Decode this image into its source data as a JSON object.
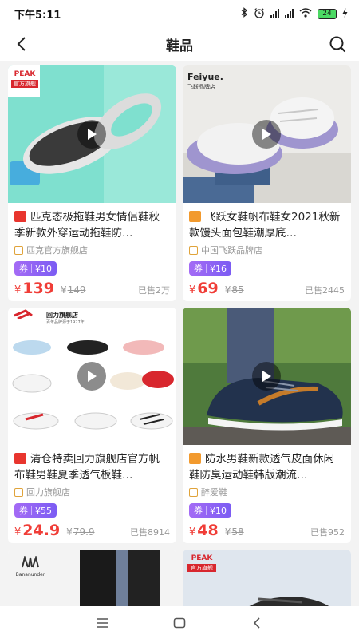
{
  "status": {
    "time": "下午5:11",
    "battery": "24"
  },
  "header": {
    "title": "鞋品"
  },
  "products": [
    {
      "name": "匹克态极拖鞋男女情侣鞋秋季新款外穿运动拖鞋防…",
      "shop": "匹克官方旗舰店",
      "coupon_label": "券",
      "coupon_value": "¥10",
      "price_symbol": "¥",
      "price": "139",
      "orig_symbol": "¥",
      "orig_price": "149",
      "sold": "已售2万",
      "brand_text": "PEAK",
      "brand_sub": "官方旗舰",
      "mall_color": "#e8352e"
    },
    {
      "name": "飞跃女鞋帆布鞋女2021秋新款馒头面包鞋潮厚底…",
      "shop": "中国飞跃品牌店",
      "coupon_label": "券",
      "coupon_value": "¥16",
      "price_symbol": "¥",
      "price": "69",
      "orig_symbol": "¥",
      "orig_price": "85",
      "sold": "已售2445",
      "brand_text": "Feiyue.",
      "brand_sub": "飞跃品牌店",
      "mall_color": "#f29a2e"
    },
    {
      "name": "清仓特卖回力旗舰店官方帆布鞋男鞋夏季透气板鞋…",
      "shop": "回力旗舰店",
      "coupon_label": "券",
      "coupon_value": "¥55",
      "price_symbol": "¥",
      "price": "24.9",
      "orig_symbol": "¥",
      "orig_price": "79.9",
      "sold": "已售8914",
      "brand_text": "回力旗舰店",
      "brand_sub": "百年品牌源于1927年",
      "mall_color": "#e8352e"
    },
    {
      "name": "防水男鞋新款透气皮面休闲鞋防臭运动鞋韩版潮流…",
      "shop": "醉爱鞋",
      "coupon_label": "券",
      "coupon_value": "¥10",
      "price_symbol": "¥",
      "price": "48",
      "orig_symbol": "¥",
      "orig_price": "58",
      "sold": "已售952",
      "brand_text": "",
      "brand_sub": "",
      "mall_color": "#f29a2e"
    }
  ],
  "partial_cards": [
    {
      "brand_text": "Bananunder"
    },
    {
      "brand_text": "PEAK",
      "brand_sub": "官方旗舰"
    }
  ],
  "colors": {
    "price": "#f03d37",
    "coupon": "#8b61f4"
  },
  "icons": [
    "back-icon",
    "search-icon",
    "play-icon",
    "shop-icon",
    "menu-icon",
    "home-icon",
    "back-nav-icon"
  ]
}
